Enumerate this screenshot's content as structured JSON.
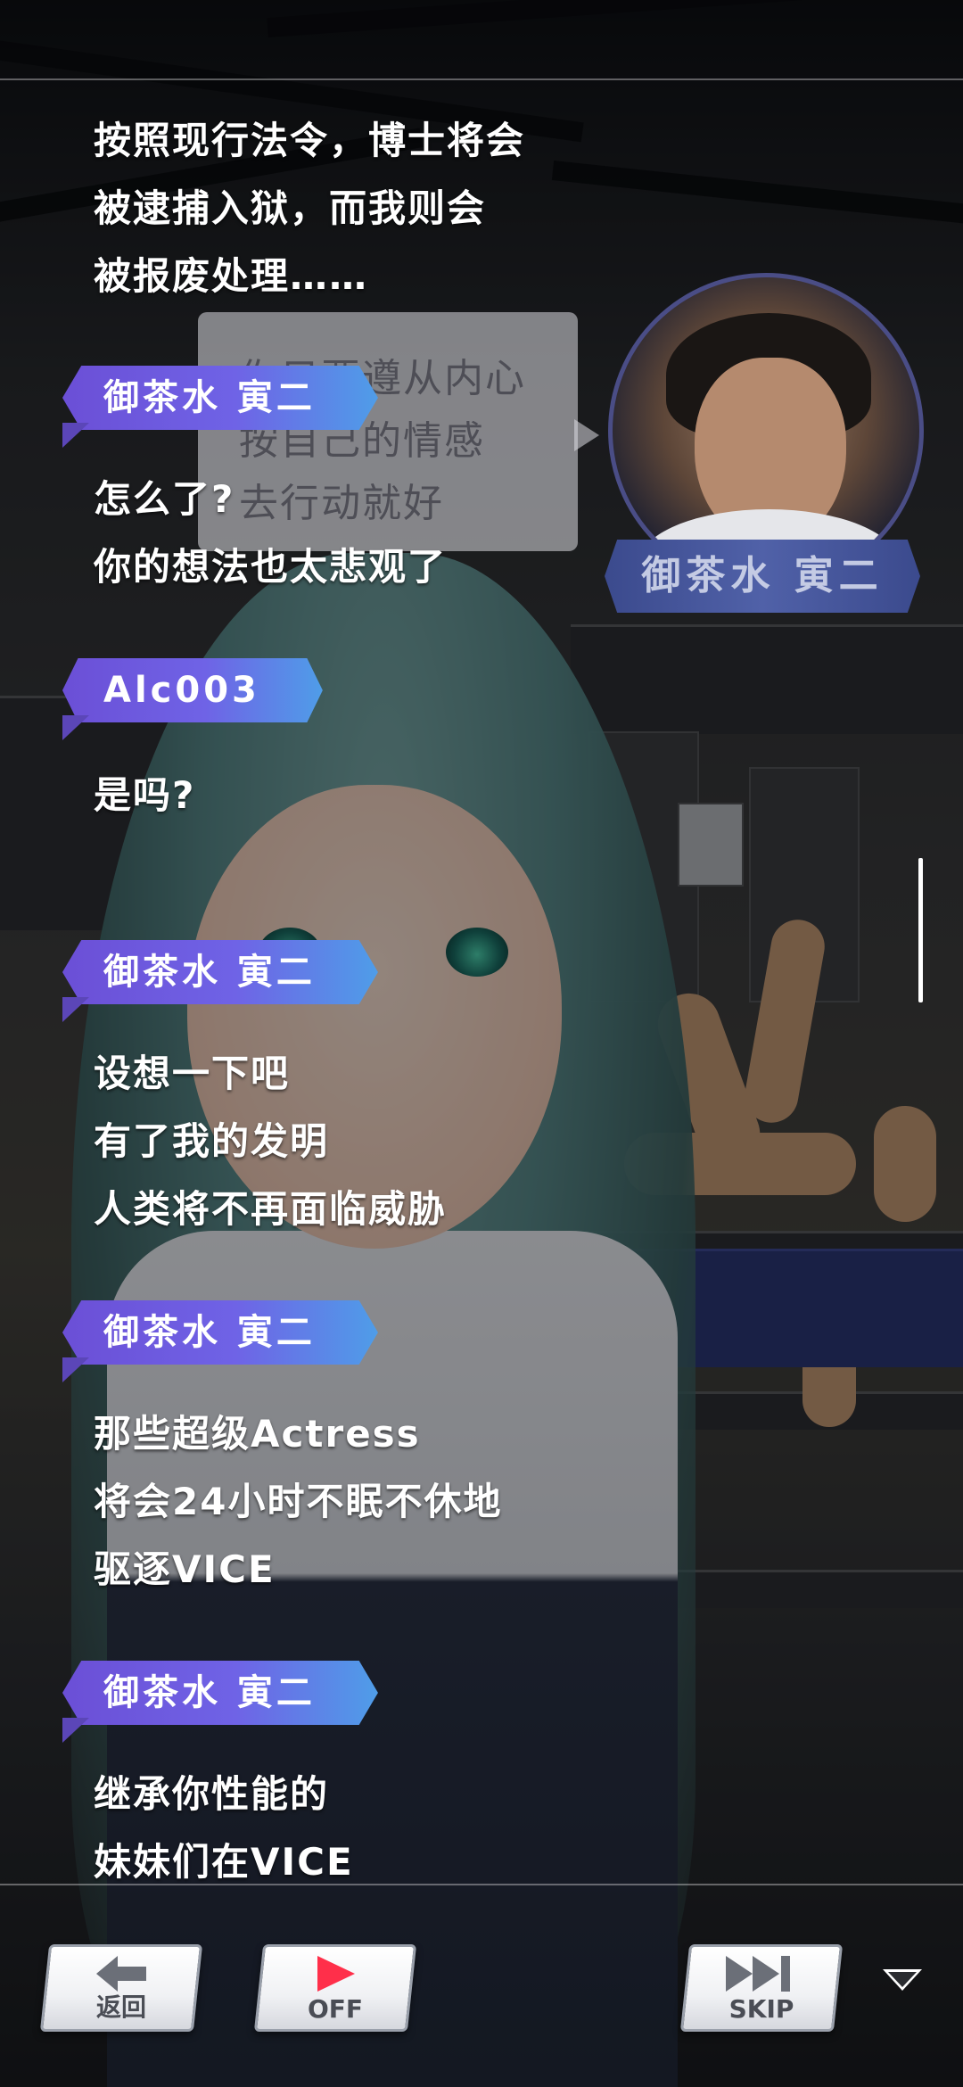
{
  "log": {
    "entries": [
      {
        "speaker": "",
        "lines": [
          "按照现行法令，博士将会",
          "被逮捕入狱，而我则会",
          "被报废处理……"
        ]
      },
      {
        "speaker": "御茶水 寅二",
        "lines": [
          "怎么了?",
          "你的想法也太悲观了"
        ]
      },
      {
        "speaker": "Alc003",
        "lines": [
          "是吗?"
        ]
      },
      {
        "speaker": "御茶水 寅二",
        "lines": [
          "设想一下吧",
          "有了我的发明",
          "人类将不再面临威胁"
        ]
      },
      {
        "speaker": "御茶水 寅二",
        "lines": [
          "那些超级Actress",
          "将会24小时不眠不休地",
          "驱逐VICE"
        ]
      },
      {
        "speaker": "御茶水 寅二",
        "lines": [
          "继承你性能的",
          "妹妹们在VICE"
        ]
      }
    ]
  },
  "portrait": {
    "speech": "你只要遵从内心\n按自己的情感\n去行动就好",
    "name": "御茶水 寅二"
  },
  "controls": {
    "back_label": "返回",
    "auto_label": "OFF",
    "skip_label": "SKIP",
    "back_icon": "arrow-left-icon",
    "auto_icon": "play-icon",
    "skip_icon": "fast-forward-icon",
    "menu_icon": "triangle-down-icon"
  },
  "colors": {
    "badge_start": "#6b4fd6",
    "badge_end": "#4f9de8",
    "auto_icon_color": "#ff2f4a",
    "icon_gray": "#6b6f78"
  }
}
